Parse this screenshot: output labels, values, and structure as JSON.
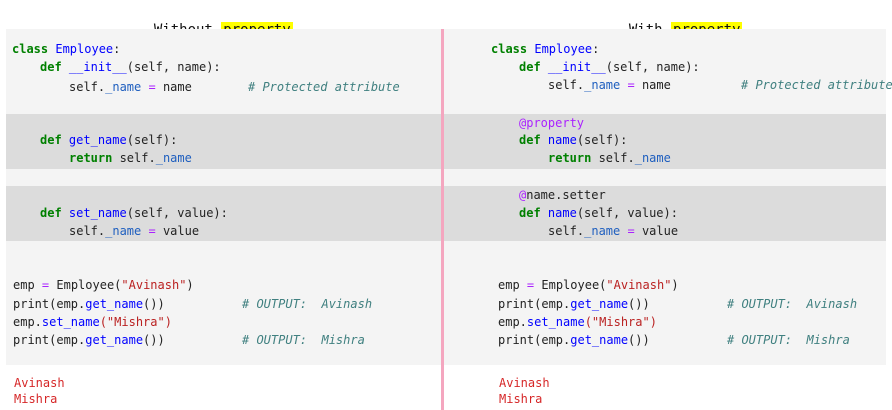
{
  "left_title": {
    "prefix": "Without ",
    "keyword": "property"
  },
  "right_title": {
    "prefix": "With ",
    "keyword": "property"
  },
  "code": {
    "class_kw": "class",
    "class_name": "Employee",
    "colon": ":",
    "def_kw": "def",
    "init_name": "__init__",
    "init_args": "(self, name):",
    "self_dot": "self.",
    "attr_name": "_name",
    "eq": "=",
    "name_var": " name",
    "comment_protected": "# Protected attribute",
    "getter_name": "get_name",
    "getter_args": "(self):",
    "return_kw": "return",
    "return_expr": " self.",
    "setter_name": "set_name",
    "setter_args": "(self, value):",
    "value_var": " value",
    "decorator_property": "@property",
    "prop_name": "name",
    "decorator_setter_at": "@",
    "decorator_setter_rest": "name.setter",
    "emp_line_a": "emp ",
    "emp_line_b": " Employee(",
    "emp_arg": "\"Avinash\"",
    "close_paren": ")",
    "print_open": "print(emp.",
    "print_close_left": "())",
    "emp_dot": "emp.",
    "set_arg": "(\"Mishra\")",
    "comment_out1": "# OUTPUT:  Avinash",
    "comment_out2": "# OUTPUT:  Mishra"
  },
  "output": {
    "line1": "Avinash",
    "line2": "Mishra"
  }
}
